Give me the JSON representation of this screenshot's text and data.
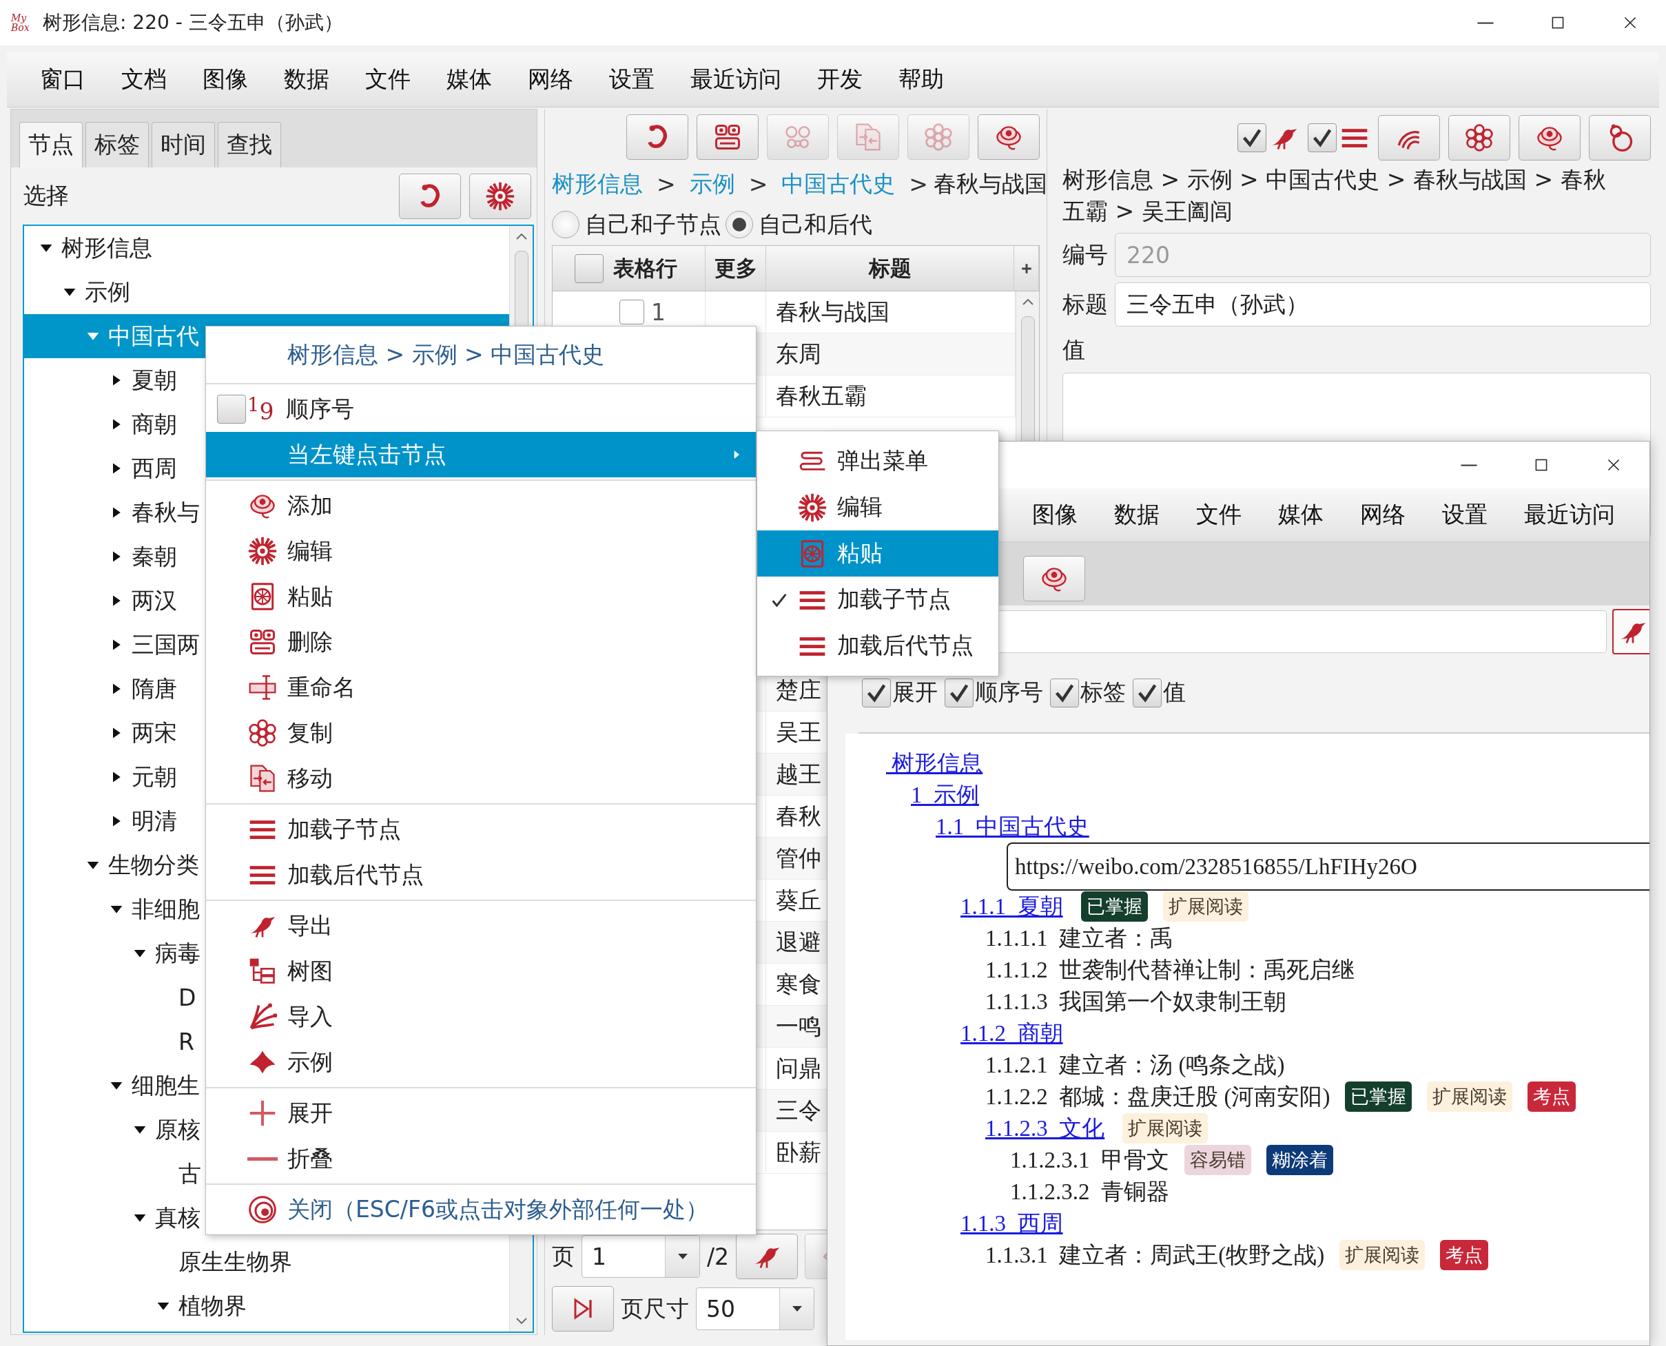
{
  "window": {
    "logo": "My Box",
    "title": "树形信息: 220 - 三令五申（孙武）"
  },
  "menu_bar": [
    "窗口",
    "文档",
    "图像",
    "数据",
    "文件",
    "媒体",
    "网络",
    "设置",
    "最近访问",
    "开发",
    "帮助"
  ],
  "left_panel": {
    "tabs": [
      {
        "label": "节点",
        "selected": true
      },
      {
        "label": "标签",
        "selected": false
      },
      {
        "label": "时间",
        "selected": false
      },
      {
        "label": "查找",
        "selected": false
      }
    ],
    "select_label": "选择",
    "tree": [
      {
        "label": "树形信息",
        "expanded": true,
        "selected": false,
        "children": [
          {
            "label": "示例",
            "expanded": true,
            "selected": false,
            "children": [
              {
                "label": "中国古代",
                "expanded": true,
                "selected": true,
                "children": [
                  {
                    "label": "夏朝",
                    "expanded": false,
                    "selected": false
                  },
                  {
                    "label": "商朝",
                    "expanded": false,
                    "selected": false
                  },
                  {
                    "label": "西周",
                    "expanded": false,
                    "selected": false
                  },
                  {
                    "label": "春秋与",
                    "expanded": false,
                    "selected": false
                  },
                  {
                    "label": "秦朝",
                    "expanded": false,
                    "selected": false
                  },
                  {
                    "label": "两汉",
                    "expanded": false,
                    "selected": false
                  },
                  {
                    "label": "三国两",
                    "expanded": false,
                    "selected": false
                  },
                  {
                    "label": "隋唐",
                    "expanded": false,
                    "selected": false
                  },
                  {
                    "label": "两宋",
                    "expanded": false,
                    "selected": false
                  },
                  {
                    "label": "元朝",
                    "expanded": false,
                    "selected": false
                  },
                  {
                    "label": "明清",
                    "expanded": false,
                    "selected": false
                  }
                ]
              },
              {
                "label": "生物分类",
                "expanded": true,
                "selected": false,
                "children": [
                  {
                    "label": "非细胞",
                    "expanded": true,
                    "selected": false,
                    "children": [
                      {
                        "label": "病毒",
                        "expanded": true,
                        "selected": false,
                        "children": [
                          {
                            "label": "D",
                            "selected": false
                          },
                          {
                            "label": "R",
                            "selected": false
                          }
                        ]
                      }
                    ]
                  },
                  {
                    "label": "细胞生",
                    "expanded": true,
                    "selected": false,
                    "children": [
                      {
                        "label": "原核",
                        "expanded": true,
                        "selected": false,
                        "children": [
                          {
                            "label": "古",
                            "selected": false
                          }
                        ]
                      },
                      {
                        "label": "真核",
                        "expanded": true,
                        "selected": false,
                        "children": [
                          {
                            "label": "原生生物界",
                            "selected": false
                          },
                          {
                            "label": "植物界",
                            "expanded": true,
                            "selected": false
                          }
                        ]
                      }
                    ]
                  }
                ]
              }
            ]
          }
        ]
      }
    ]
  },
  "middle_panel": {
    "toolbar": [
      {
        "disabled": false
      },
      {
        "disabled": false
      },
      {
        "disabled": true
      },
      {
        "disabled": true
      },
      {
        "disabled": true
      },
      {
        "disabled": false
      }
    ],
    "breadcrumb": [
      {
        "kind": "link",
        "text": "树形信息"
      },
      {
        "kind": "separator",
        "text": ">"
      },
      {
        "kind": "link",
        "text": "示例"
      },
      {
        "kind": "separator",
        "text": ">"
      },
      {
        "kind": "link",
        "text": "中国古代史"
      },
      {
        "kind": "separator",
        "text": ">"
      },
      {
        "kind": "current",
        "text": "春秋与战国"
      }
    ],
    "scope_options": [
      {
        "label": "自己和子节点",
        "selected": false
      },
      {
        "label": "自己和后代",
        "selected": true
      }
    ],
    "table": {
      "header_checked": false,
      "columns": [
        "表格行",
        "更多",
        "标题"
      ],
      "rows": [
        {
          "row_number": "1",
          "checked": false,
          "title": "春秋与战国"
        },
        {
          "title": "东周"
        },
        {
          "title": "春秋五霸"
        },
        {
          "title": "楚庄"
        },
        {
          "title": "吴王"
        },
        {
          "title": "越王"
        },
        {
          "title": "春秋"
        },
        {
          "title": "管仲"
        },
        {
          "title": "葵丘"
        },
        {
          "title": "退避"
        },
        {
          "title": "寒食"
        },
        {
          "title": "一鸣"
        },
        {
          "title": "问鼎"
        },
        {
          "title": "三令"
        },
        {
          "title": "卧薪"
        }
      ]
    },
    "pager": {
      "page_label": "页",
      "page": "1",
      "page_total": "/2",
      "nav_buttons": [
        {
          "disabled": false
        },
        {
          "disabled": true
        }
      ],
      "page_size_label": "页尺寸",
      "page_size": "50"
    }
  },
  "right_panel": {
    "toggles": [
      {
        "checked": true
      },
      {
        "checked": true
      }
    ],
    "buttons": [
      {
        "disabled": false
      },
      {
        "disabled": false
      },
      {
        "disabled": false
      },
      {
        "disabled": false
      }
    ],
    "path": "树形信息 > 示例 > 中国古代史 > 春秋与战国 > 春秋五霸 > 吴王阖闾",
    "fields": [
      {
        "label": "编号",
        "value": "220",
        "disabled": true
      },
      {
        "label": "标题",
        "value": "三令五申（孙武）",
        "disabled": false
      }
    ],
    "value_label": "值"
  },
  "context_menu": {
    "groups": [
      [
        {
          "kind": "header",
          "text": "树形信息 > 示例 > 中国古代史"
        }
      ],
      [
        {
          "kind": "check",
          "icon_text": "$^{1}$9",
          "label": "顺序号",
          "checked": false,
          "selected": false
        },
        {
          "kind": "submenu",
          "label": "当左键点击节点",
          "selected": true
        }
      ],
      [
        {
          "kind": "action",
          "label": "添加",
          "selected": false
        },
        {
          "kind": "action",
          "label": "编辑",
          "selected": false
        },
        {
          "kind": "action",
          "label": "粘贴",
          "selected": false
        },
        {
          "kind": "action",
          "label": "删除",
          "selected": false
        },
        {
          "kind": "action",
          "label": "重命名",
          "selected": false
        },
        {
          "kind": "action",
          "label": "复制",
          "selected": false
        },
        {
          "kind": "action",
          "label": "移动",
          "selected": false
        }
      ],
      [
        {
          "kind": "action",
          "label": "加载子节点",
          "selected": false
        },
        {
          "kind": "action",
          "label": "加载后代节点",
          "selected": false
        }
      ],
      [
        {
          "kind": "action",
          "label": "导出",
          "selected": false
        },
        {
          "kind": "action",
          "label": "树图",
          "selected": false
        },
        {
          "kind": "action",
          "label": "导入",
          "selected": false
        },
        {
          "kind": "action",
          "label": "示例",
          "selected": false
        }
      ],
      [
        {
          "kind": "action",
          "label": "展开",
          "selected": false
        },
        {
          "kind": "action",
          "label": "折叠",
          "selected": false
        }
      ],
      [
        {
          "kind": "close",
          "label": "关闭（ESC/F6或点击对象外部任何一处）",
          "selected": false
        }
      ]
    ]
  },
  "submenu": {
    "items": [
      {
        "label": "弹出菜单",
        "checked": false,
        "selected": false
      },
      {
        "label": "编辑",
        "checked": false,
        "selected": false
      },
      {
        "label": "粘贴",
        "checked": false,
        "selected": true
      },
      {
        "label": "加载子节点",
        "checked": true,
        "selected": false
      },
      {
        "label": "加载后代节点",
        "checked": false,
        "selected": false
      }
    ]
  },
  "second_window": {
    "menu": [
      "图像",
      "数据",
      "文件",
      "媒体",
      "网络",
      "设置",
      "最近访问"
    ],
    "options": [
      {
        "label": "展开",
        "checked": true
      },
      {
        "label": "顺序号",
        "checked": true
      },
      {
        "label": "标签",
        "checked": true
      },
      {
        "label": "值",
        "checked": true
      }
    ],
    "outline": [
      {
        "label": " 树形信息",
        "link": true,
        "children": [
          {
            "label": "1  示例",
            "link": true,
            "children": [
              {
                "label": "1.1  中国古代史",
                "link": true,
                "url": "https://weibo.com/2328516855/LhFIHy26O",
                "children": [
                  {
                    "label": "1.1.1  夏朝",
                    "link": true,
                    "tags": [
                      {
                        "text": "已掌握",
                        "color": "#133f2c"
                      },
                      {
                        "text": "扩展阅读",
                        "color": "#fdf0dc"
                      }
                    ],
                    "children": [
                      {
                        "label": "1.1.1.1  建立者：禹",
                        "link": false
                      },
                      {
                        "label": "1.1.1.2  世袭制代替禅让制：禹死启继",
                        "link": false
                      },
                      {
                        "label": "1.1.1.3  我国第一个奴隶制王朝",
                        "link": false
                      }
                    ]
                  },
                  {
                    "label": "1.1.2  商朝",
                    "link": true,
                    "children": [
                      {
                        "label": "1.1.2.1  建立者：汤 (鸣条之战)",
                        "link": false
                      },
                      {
                        "label": "1.1.2.2  都城：盘庚迁股 (河南安阳)",
                        "link": false,
                        "tags": [
                          {
                            "text": "已掌握",
                            "color": "#133f2c"
                          },
                          {
                            "text": "扩展阅读",
                            "color": "#fdf0dc"
                          },
                          {
                            "text": "考点",
                            "color": "#c9283a"
                          }
                        ]
                      },
                      {
                        "label": "1.1.2.3  文化",
                        "link": true,
                        "tags": [
                          {
                            "text": "扩展阅读",
                            "color": "#fdf0dc"
                          }
                        ],
                        "children": [
                          {
                            "label": "1.1.2.3.1  甲骨文",
                            "link": false,
                            "tags": [
                              {
                                "text": "容易错",
                                "color": "#ecd5dc"
                              },
                              {
                                "text": "糊涂着",
                                "color": "#0d3a78"
                              }
                            ]
                          },
                          {
                            "label": "1.1.2.3.2  青铜器",
                            "link": false
                          }
                        ]
                      }
                    ]
                  },
                  {
                    "label": "1.1.3  西周",
                    "link": true,
                    "children": [
                      {
                        "label": "1.1.3.1  建立者：周武王(牧野之战)",
                        "link": false,
                        "tags": [
                          {
                            "text": "扩展阅读",
                            "color": "#fdf0dc"
                          },
                          {
                            "text": "考点",
                            "color": "#c9283a"
                          }
                        ]
                      }
                    ]
                  }
                ]
              }
            ]
          }
        ]
      }
    ]
  }
}
